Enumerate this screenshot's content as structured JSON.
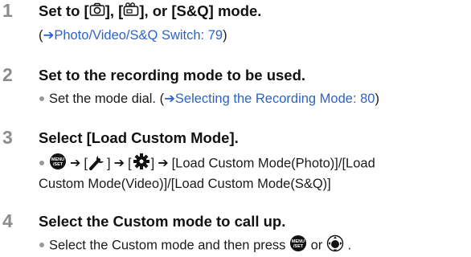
{
  "steps": [
    {
      "number": "1",
      "title_prefix": "Set to [",
      "title_sep1": "], [",
      "title_suffix": "], or [S&Q] mode.",
      "ref_open": "(",
      "ref_arrow": "➔",
      "ref_link": "Photo/Video/S&Q Switch: 79",
      "ref_close": ")"
    },
    {
      "number": "2",
      "title": "Set to the recording mode to be used.",
      "line_text": "Set the mode dial. (",
      "ref_arrow": "➔",
      "ref_link": "Selecting the Recording Mode: 80",
      "ref_close": ")"
    },
    {
      "number": "3",
      "title": "Select [Load Custom Mode].",
      "arrow": "➔",
      "bracket_open": "[",
      "bracket_close": "]",
      "line1_tail": "[Load Custom Mode(Photo)]/[Load",
      "line2": "Custom Mode(Video)]/[Load Custom Mode(S&Q)]"
    },
    {
      "number": "4",
      "title": "Select the Custom mode to call up.",
      "line_text": "Select the Custom mode and then press",
      "or_text": "or",
      "end_text": "."
    }
  ],
  "menu_icon_label": "MENU\n/SET",
  "colors": {
    "link": "#2d63c8",
    "step_number": "#8c8c8c",
    "text": "#111111"
  }
}
